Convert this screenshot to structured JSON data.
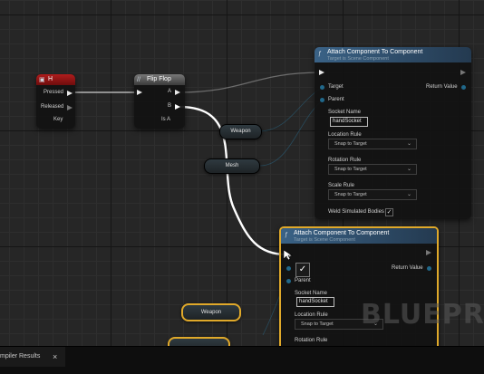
{
  "watermark": "BLUEPRI",
  "h_node": {
    "title": "H",
    "pins": {
      "pressed": "Pressed",
      "released": "Released",
      "key": "Key"
    },
    "header_color": "#8a1414"
  },
  "flipflop_node": {
    "title": "Flip Flop",
    "pins": {
      "a": "A",
      "b": "B",
      "is_a": "Is A"
    },
    "header_color": "#5c5c5c"
  },
  "attach_node_1": {
    "title": "Attach Component To Component",
    "subtitle": "Target is Scene Component",
    "header_color": "#2d4a66",
    "pins": {
      "target": "Target",
      "parent": "Parent",
      "return_value": "Return Value",
      "socket_name": "Socket Name",
      "socket_value": "handSocket",
      "location_rule": "Location Rule",
      "location_value": "Snap to Target",
      "rotation_rule": "Rotation Rule",
      "rotation_value": "Snap to Target",
      "scale_rule": "Scale Rule",
      "scale_value": "Snap to Target",
      "weld": "Weld Simulated Bodies",
      "weld_checked": "✓"
    }
  },
  "attach_node_2": {
    "title": "Attach Component To Component",
    "subtitle": "Target is Scene Component",
    "header_color": "#2d4a66",
    "pins": {
      "parent": "Parent",
      "return_value": "Return Value",
      "socket_name": "Socket Name",
      "socket_value": "handSocket",
      "location_rule": "Location Rule",
      "location_value": "Snap to Target",
      "rotation_rule": "Rotation Rule"
    }
  },
  "variables": {
    "weapon_1": "Weapon",
    "mesh": "Mesh",
    "weapon_2": "Weapon"
  },
  "bottom_tab": {
    "label": "mpiler Results",
    "close": "×"
  },
  "icons": {
    "h_node_icon": "keyboard-event-icon",
    "flipflop_icon": "macro-icon",
    "function_icon": "function-icon",
    "dropdown": "chevron-down-icon"
  },
  "colors": {
    "selection": "#e0a92a",
    "object_pin": "#2aa0d8",
    "exec_wire": "#ffffff"
  }
}
